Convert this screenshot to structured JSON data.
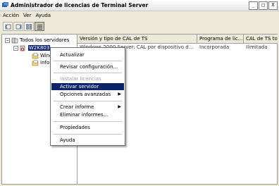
{
  "window": {
    "title": "Administrador de licencias de Terminal Server"
  },
  "title_buttons": {
    "minimize": "_",
    "maximize": "□",
    "close": "X"
  },
  "menubar": {
    "items": [
      "Acción",
      "Ver",
      "Ayuda"
    ]
  },
  "toolbar": {
    "buttons": [
      "back-icon",
      "forward-icon",
      "view-icon",
      "list-view-icon"
    ]
  },
  "tree": {
    "root_label": "Todos los servidores",
    "server_label": "W2K803",
    "child1_label": "Wind",
    "child2_label": "Info"
  },
  "list": {
    "columns": [
      "Versión y tipo de CAL de TS",
      "Programa de lic...",
      "CAL de TS total"
    ],
    "rows": [
      [
        "Windows 2000 Server: CAL por dispositivo d...",
        "Incorporada",
        "Ilimitada"
      ]
    ]
  },
  "context_menu": {
    "items": [
      {
        "label": "Actualizar"
      },
      {
        "label": "Revisar configuración..."
      },
      {
        "label": "Instalar licencias",
        "disabled": true
      },
      {
        "label": "Activar servidor",
        "highlighted": true
      },
      {
        "label": "Opciones avanzadas",
        "submenu": true
      },
      {
        "label": "Crear informe",
        "submenu": true
      },
      {
        "label": "Eliminar informes..."
      },
      {
        "label": "Propiedades"
      },
      {
        "label": "Ayuda"
      }
    ]
  },
  "colors": {
    "highlight": "#0a246a",
    "disabled_text": "#a0a0a0",
    "background": "#ece9d8"
  }
}
